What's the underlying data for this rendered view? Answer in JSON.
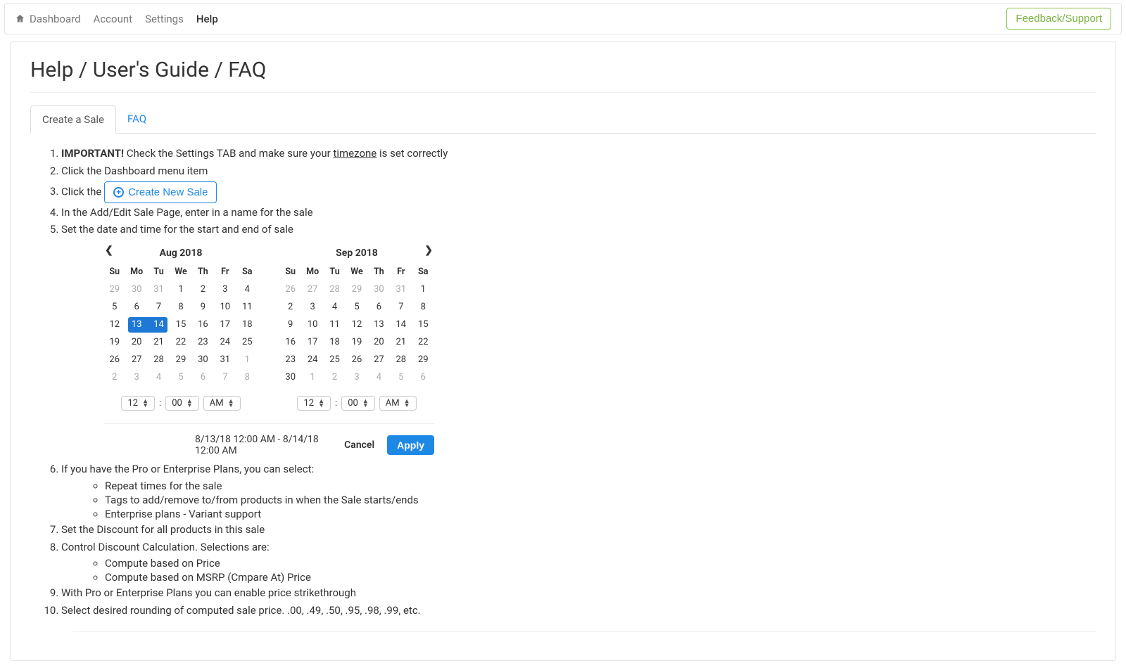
{
  "topnav": {
    "dashboard": "Dashboard",
    "account": "Account",
    "settings": "Settings",
    "help": "Help"
  },
  "feedback_btn": "Feedback/Support",
  "page_title": "Help / User's Guide / FAQ",
  "tabs": {
    "create_sale": "Create a Sale",
    "faq": "FAQ"
  },
  "steps": {
    "s1_important": "IMPORTANT!",
    "s1_a": " Check the Settings TAB and make sure your ",
    "s1_tz": "timezone",
    "s1_b": " is set correctly",
    "s2": "Click the Dashboard menu item",
    "s3_prefix": "Click the ",
    "create_btn": "Create New Sale",
    "s4": "In the Add/Edit Sale Page, enter in a name for the sale",
    "s5": "Set the date and time for the start and end of sale",
    "s6": "If you have the Pro or Enterprise Plans, you can select:",
    "s6a": "Repeat times for the sale",
    "s6b": "Tags to add/remove to/from products in when the Sale starts/ends",
    "s6c": "Enterprise plans - Variant support",
    "s7": "Set the Discount for all products in this sale",
    "s8": "Control Discount Calculation. Selections are:",
    "s8a": "Compute based on Price",
    "s8b": "Compute based on MSRP (Cmpare At) Price",
    "s9": "With Pro or Enterprise Plans you can enable price strikethrough",
    "s10": "Select desired rounding of computed sale price. .00, .49, .50, .95, .98, .99, etc."
  },
  "calendar": {
    "dow": [
      "Su",
      "Mo",
      "Tu",
      "We",
      "Th",
      "Fr",
      "Sa"
    ],
    "left": {
      "title": "Aug 2018",
      "rows": [
        [
          {
            "d": "29",
            "off": true
          },
          {
            "d": "30",
            "off": true
          },
          {
            "d": "31",
            "off": true
          },
          {
            "d": "1"
          },
          {
            "d": "2"
          },
          {
            "d": "3"
          },
          {
            "d": "4"
          }
        ],
        [
          {
            "d": "5"
          },
          {
            "d": "6"
          },
          {
            "d": "7"
          },
          {
            "d": "8"
          },
          {
            "d": "9"
          },
          {
            "d": "10"
          },
          {
            "d": "11"
          }
        ],
        [
          {
            "d": "12"
          },
          {
            "d": "13",
            "sel": "start"
          },
          {
            "d": "14",
            "sel": "end"
          },
          {
            "d": "15"
          },
          {
            "d": "16"
          },
          {
            "d": "17"
          },
          {
            "d": "18"
          }
        ],
        [
          {
            "d": "19"
          },
          {
            "d": "20"
          },
          {
            "d": "21"
          },
          {
            "d": "22"
          },
          {
            "d": "23"
          },
          {
            "d": "24"
          },
          {
            "d": "25"
          }
        ],
        [
          {
            "d": "26"
          },
          {
            "d": "27"
          },
          {
            "d": "28"
          },
          {
            "d": "29"
          },
          {
            "d": "30"
          },
          {
            "d": "31"
          },
          {
            "d": "1",
            "off": true
          }
        ],
        [
          {
            "d": "2",
            "off": true
          },
          {
            "d": "3",
            "off": true
          },
          {
            "d": "4",
            "off": true
          },
          {
            "d": "5",
            "off": true
          },
          {
            "d": "6",
            "off": true
          },
          {
            "d": "7",
            "off": true
          },
          {
            "d": "8",
            "off": true
          }
        ]
      ]
    },
    "right": {
      "title": "Sep 2018",
      "rows": [
        [
          {
            "d": "26",
            "off": true
          },
          {
            "d": "27",
            "off": true
          },
          {
            "d": "28",
            "off": true
          },
          {
            "d": "29",
            "off": true
          },
          {
            "d": "30",
            "off": true
          },
          {
            "d": "31",
            "off": true
          },
          {
            "d": "1"
          }
        ],
        [
          {
            "d": "2"
          },
          {
            "d": "3"
          },
          {
            "d": "4"
          },
          {
            "d": "5"
          },
          {
            "d": "6"
          },
          {
            "d": "7"
          },
          {
            "d": "8"
          }
        ],
        [
          {
            "d": "9"
          },
          {
            "d": "10"
          },
          {
            "d": "11"
          },
          {
            "d": "12"
          },
          {
            "d": "13"
          },
          {
            "d": "14"
          },
          {
            "d": "15"
          }
        ],
        [
          {
            "d": "16"
          },
          {
            "d": "17"
          },
          {
            "d": "18"
          },
          {
            "d": "19"
          },
          {
            "d": "20"
          },
          {
            "d": "21"
          },
          {
            "d": "22"
          }
        ],
        [
          {
            "d": "23"
          },
          {
            "d": "24"
          },
          {
            "d": "25"
          },
          {
            "d": "26"
          },
          {
            "d": "27"
          },
          {
            "d": "28"
          },
          {
            "d": "29"
          }
        ],
        [
          {
            "d": "30"
          },
          {
            "d": "1",
            "off": true
          },
          {
            "d": "2",
            "off": true
          },
          {
            "d": "3",
            "off": true
          },
          {
            "d": "4",
            "off": true
          },
          {
            "d": "5",
            "off": true
          },
          {
            "d": "6",
            "off": true
          }
        ]
      ]
    },
    "time": {
      "hour": "12",
      "minute": "00",
      "ampm": "AM",
      "colon": ":"
    },
    "range_text": "8/13/18 12:00 AM - 8/14/18 12:00 AM",
    "cancel": "Cancel",
    "apply": "Apply"
  }
}
